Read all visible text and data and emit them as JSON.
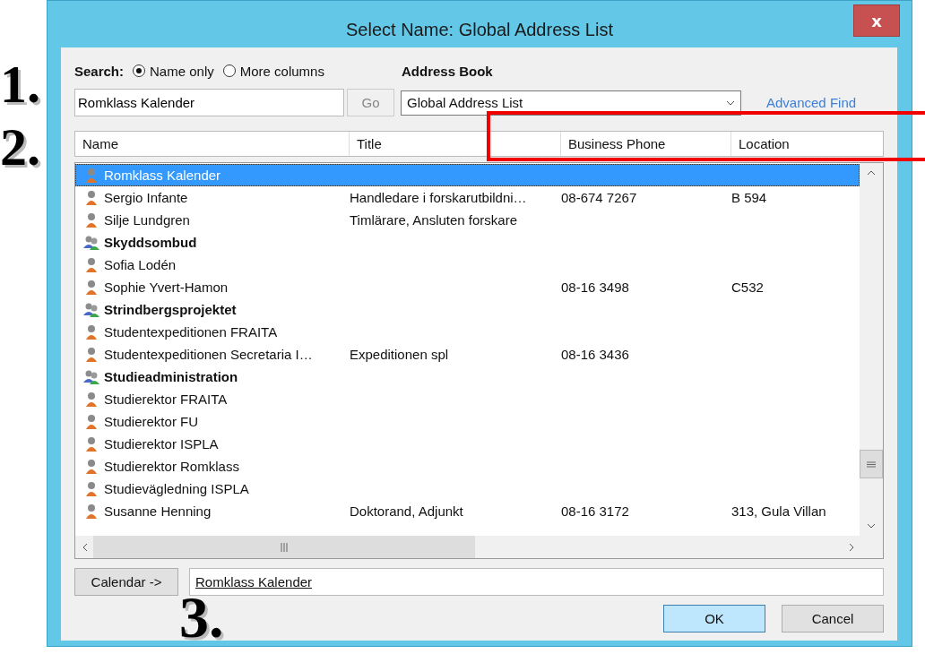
{
  "window": {
    "title": "Select Name: Global Address List",
    "close_glyph": "x"
  },
  "search": {
    "label": "Search:",
    "options": [
      {
        "label": "Name only",
        "selected": true
      },
      {
        "label": "More columns",
        "selected": false
      }
    ],
    "query": "Romklass Kalender",
    "go_button": "Go"
  },
  "address_book": {
    "label": "Address Book",
    "value": "Global Address List",
    "advanced_find": "Advanced Find"
  },
  "columns": [
    "Name",
    "Title",
    "Business Phone",
    "Location"
  ],
  "rows": [
    {
      "kind": "person",
      "name": "Romklass Kalender",
      "selected": true
    },
    {
      "kind": "person",
      "name": "Sergio Infante",
      "title": "Handledare i forskarutbildni…",
      "phone": "08-674 7267",
      "location": "B 594",
      "selected": false
    },
    {
      "kind": "person",
      "name": "Silje Lundgren",
      "title": "Timlärare, Ansluten forskare",
      "selected": false
    },
    {
      "kind": "group",
      "name": "Skyddsombud",
      "selected": false
    },
    {
      "kind": "person",
      "name": "Sofia Lodén",
      "selected": false
    },
    {
      "kind": "person",
      "name": "Sophie Yvert-Hamon",
      "phone": "08-16 3498",
      "location": "C532",
      "selected": false
    },
    {
      "kind": "group",
      "name": "Strindbergsprojektet",
      "selected": false
    },
    {
      "kind": "person",
      "name": "Studentexpeditionen FRAITA",
      "selected": false
    },
    {
      "kind": "person",
      "name": "Studentexpeditionen Secretaria I…",
      "title": "Expeditionen spl",
      "phone": "08-16 3436",
      "selected": false
    },
    {
      "kind": "group",
      "name": "Studieadministration",
      "selected": false
    },
    {
      "kind": "person",
      "name": "Studierektor FRAITA",
      "selected": false
    },
    {
      "kind": "person",
      "name": "Studierektor FU",
      "selected": false
    },
    {
      "kind": "person",
      "name": "Studierektor ISPLA",
      "selected": false
    },
    {
      "kind": "person",
      "name": "Studierektor Romklass",
      "selected": false
    },
    {
      "kind": "person",
      "name": "Studievägledning ISPLA",
      "selected": false
    },
    {
      "kind": "person",
      "name": "Susanne Henning",
      "title": "Doktorand, Adjunkt",
      "phone": "08-16 3172",
      "location": "313, Gula Villan",
      "selected": false
    }
  ],
  "calendar_button": "Calendar ->",
  "chosen": "Romklass Kalender",
  "buttons": [
    {
      "label": "OK",
      "kind": "default"
    },
    {
      "label": "Cancel",
      "kind": "normal"
    }
  ],
  "annotations": [
    "1.",
    "2.",
    "3."
  ]
}
